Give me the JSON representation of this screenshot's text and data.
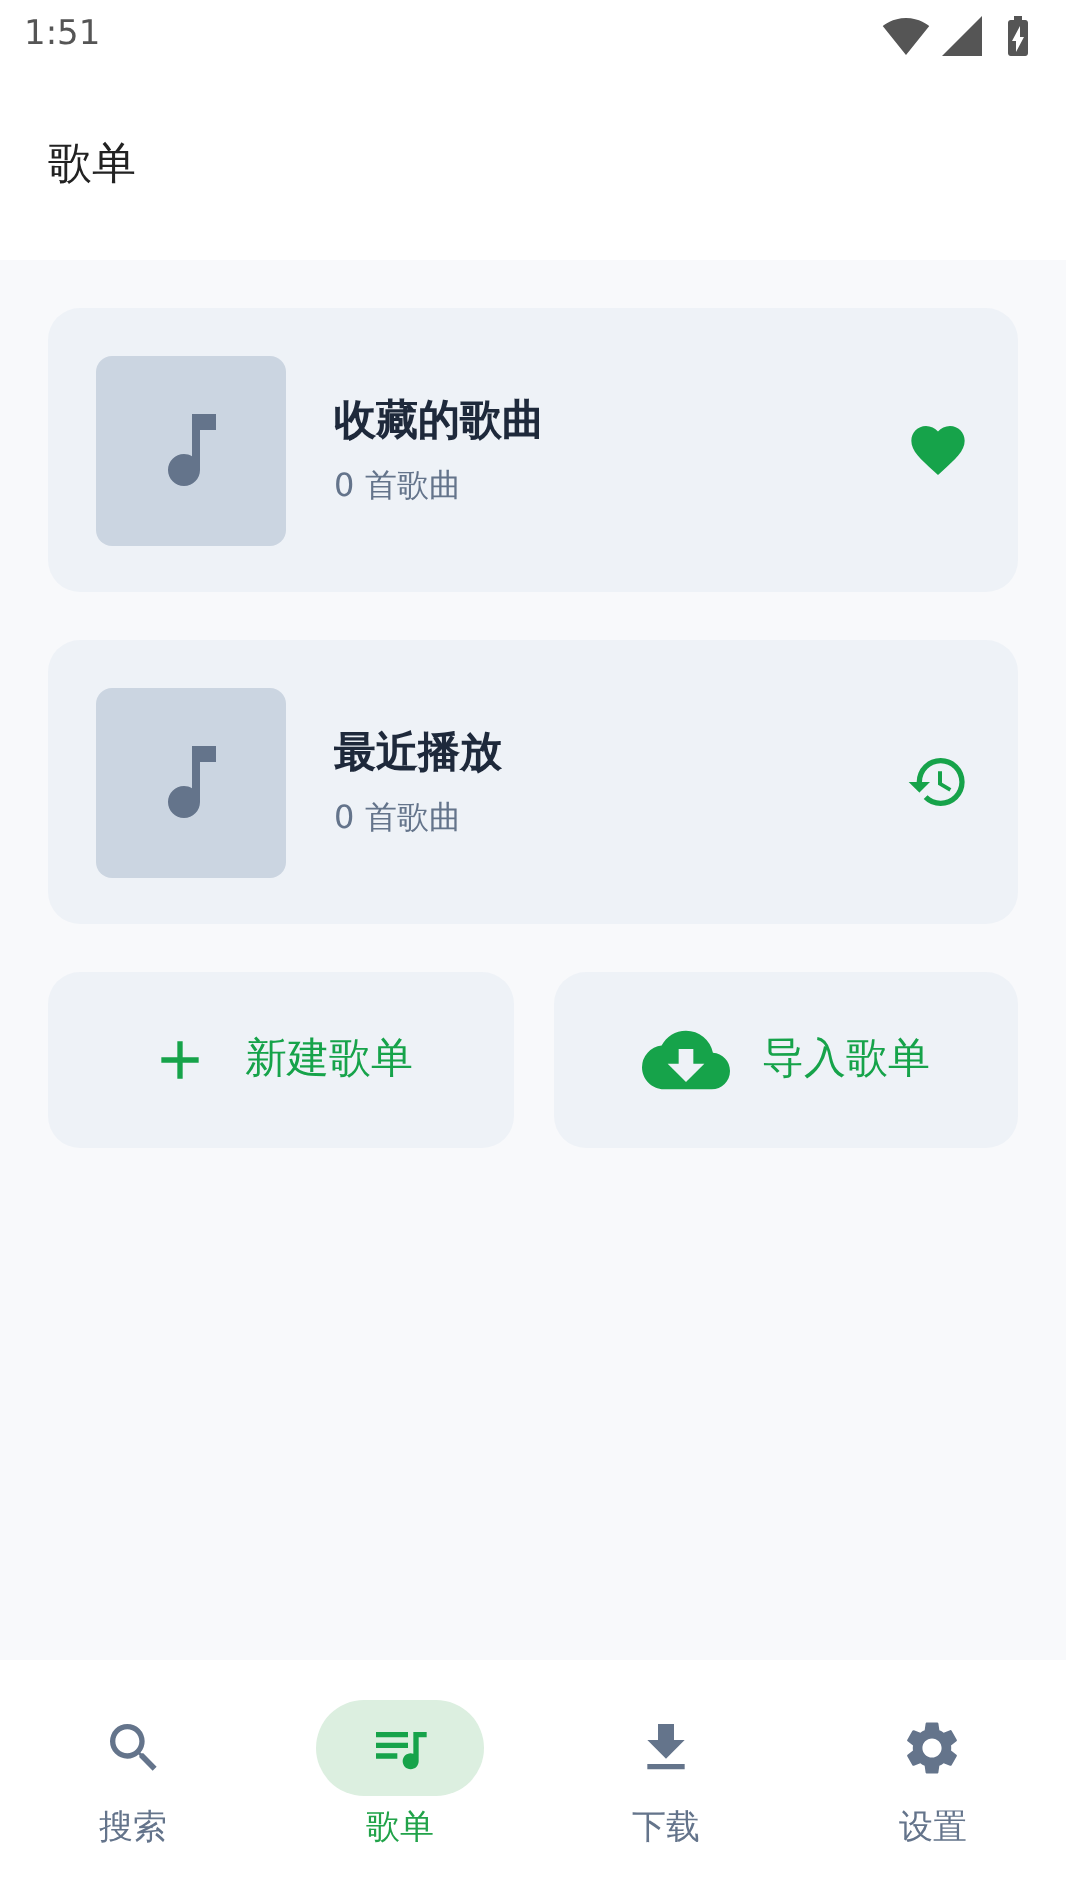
{
  "status_bar": {
    "time": "1:51"
  },
  "header": {
    "title": "歌单"
  },
  "playlists": [
    {
      "kind": "favorites",
      "title": "收藏的歌曲",
      "subtitle": "0 首歌曲"
    },
    {
      "kind": "recent",
      "title": "最近播放",
      "subtitle": "0 首歌曲"
    }
  ],
  "actions": [
    {
      "kind": "new",
      "label": "新建歌单"
    },
    {
      "kind": "import",
      "label": "导入歌单"
    }
  ],
  "bottom_nav": [
    {
      "kind": "search",
      "label": "搜索",
      "selected": false
    },
    {
      "kind": "playlists",
      "label": "歌单",
      "selected": true
    },
    {
      "kind": "download",
      "label": "下载",
      "selected": false
    },
    {
      "kind": "settings",
      "label": "设置",
      "selected": false
    }
  ]
}
